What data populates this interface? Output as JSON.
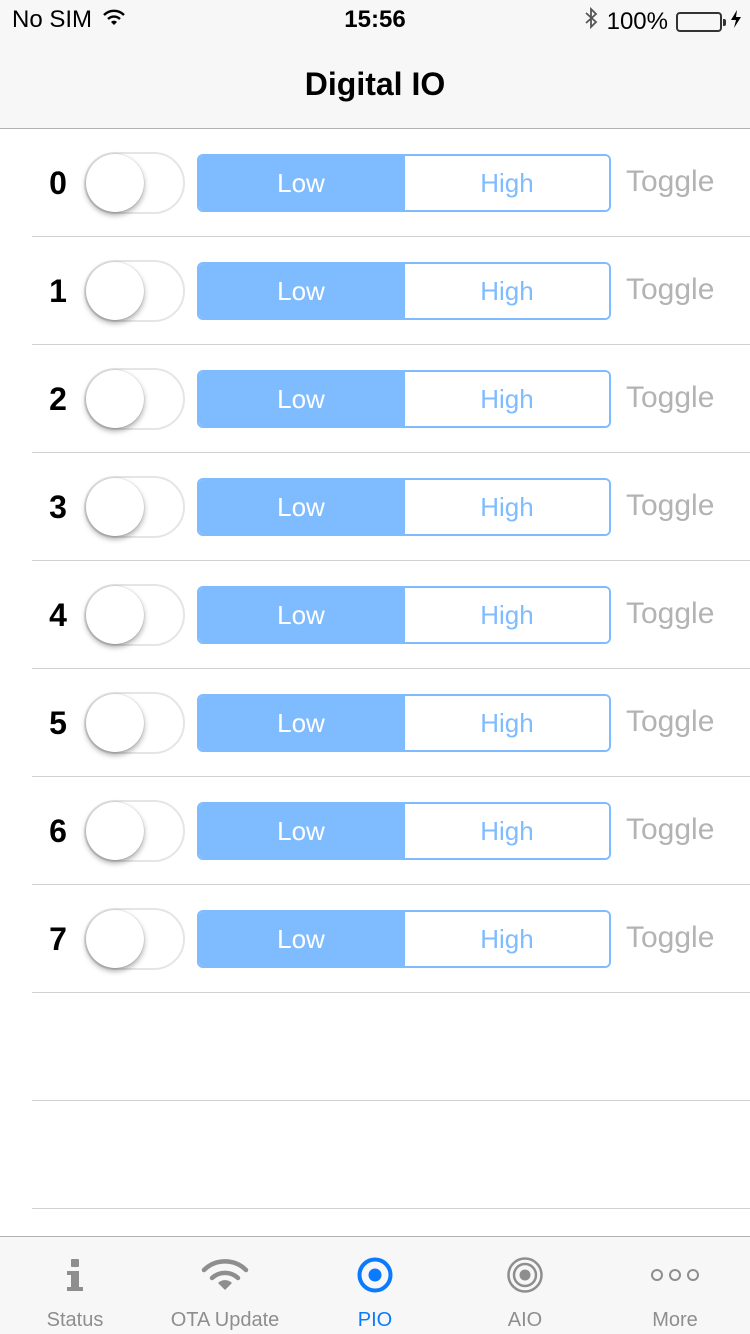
{
  "status_bar": {
    "carrier": "No SIM",
    "time": "15:56",
    "battery": "100%",
    "wifi_icon": "wifi-icon",
    "bluetooth_icon": "bluetooth-icon",
    "battery_level": 1.0,
    "battery_color": "#4cd964"
  },
  "nav": {
    "title": "Digital IO"
  },
  "segment_labels": {
    "low": "Low",
    "high": "High"
  },
  "toggle_label": "Toggle",
  "pins": [
    {
      "label": "0",
      "switch_on": false,
      "selected": "Low"
    },
    {
      "label": "1",
      "switch_on": false,
      "selected": "Low"
    },
    {
      "label": "2",
      "switch_on": false,
      "selected": "Low"
    },
    {
      "label": "3",
      "switch_on": false,
      "selected": "Low"
    },
    {
      "label": "4",
      "switch_on": false,
      "selected": "Low"
    },
    {
      "label": "5",
      "switch_on": false,
      "selected": "Low"
    },
    {
      "label": "6",
      "switch_on": false,
      "selected": "Low"
    },
    {
      "label": "7",
      "switch_on": false,
      "selected": "Low"
    }
  ],
  "tabs": [
    {
      "label": "Status",
      "icon": "info-icon",
      "active": false
    },
    {
      "label": "OTA Update",
      "icon": "wifi-icon",
      "active": false
    },
    {
      "label": "PIO",
      "icon": "target-icon",
      "active": true
    },
    {
      "label": "AIO",
      "icon": "concentric-circles-icon",
      "active": false
    },
    {
      "label": "More",
      "icon": "more-icon",
      "active": false
    }
  ],
  "colors": {
    "accent": "#7fbcff",
    "tab_active": "#0a7aff",
    "tab_inactive": "#8e8e8e",
    "toggle_text": "#b3b3b3"
  }
}
